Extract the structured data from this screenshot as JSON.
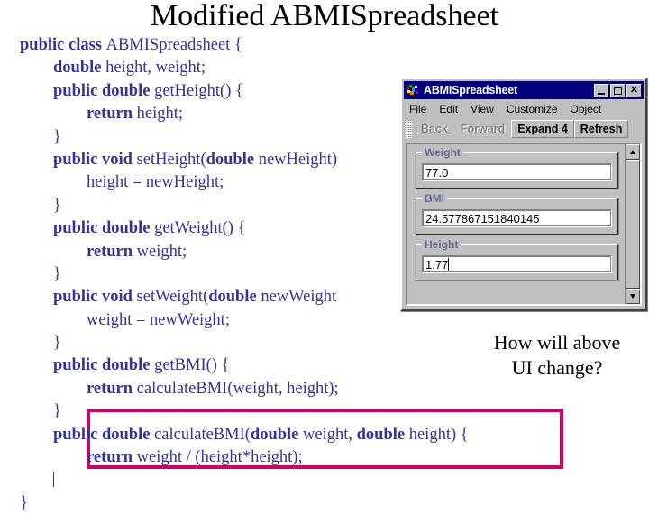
{
  "slide": {
    "title": "Modified ABMISpreadsheet",
    "question": "How will above UI change?",
    "question_line1": "How will above",
    "question_line2": "UI change?",
    "highlight_color": "#cc0066",
    "code_color": "#333399"
  },
  "code": {
    "lines": [
      {
        "indent": 0,
        "parts": [
          {
            "t": "public class ",
            "b": true
          },
          {
            "t": "ABMISpreadsheet {",
            "b": false
          }
        ]
      },
      {
        "indent": 1,
        "parts": [
          {
            "t": "double ",
            "b": true
          },
          {
            "t": "height, weight;",
            "b": false
          }
        ]
      },
      {
        "indent": 1,
        "parts": [
          {
            "t": "public double ",
            "b": true
          },
          {
            "t": "getHeight() {",
            "b": false
          }
        ]
      },
      {
        "indent": 2,
        "parts": [
          {
            "t": "return ",
            "b": true
          },
          {
            "t": "height;",
            "b": false
          }
        ]
      },
      {
        "indent": 1,
        "parts": [
          {
            "t": "}",
            "b": false
          }
        ]
      },
      {
        "indent": 1,
        "parts": [
          {
            "t": "public void ",
            "b": true
          },
          {
            "t": "setHeight(",
            "b": false
          },
          {
            "t": "double ",
            "b": true
          },
          {
            "t": "newHeight)",
            "b": false
          }
        ]
      },
      {
        "indent": 2,
        "parts": [
          {
            "t": "height = newHeight;",
            "b": false
          }
        ]
      },
      {
        "indent": 1,
        "parts": [
          {
            "t": "}",
            "b": false
          }
        ]
      },
      {
        "indent": 1,
        "parts": [
          {
            "t": "public double ",
            "b": true
          },
          {
            "t": "getWeight() {",
            "b": false
          }
        ]
      },
      {
        "indent": 2,
        "parts": [
          {
            "t": "return ",
            "b": true
          },
          {
            "t": "weight;",
            "b": false
          }
        ]
      },
      {
        "indent": 1,
        "parts": [
          {
            "t": "}",
            "b": false
          }
        ]
      },
      {
        "indent": 1,
        "parts": [
          {
            "t": "public void ",
            "b": true
          },
          {
            "t": "setWeight(",
            "b": false
          },
          {
            "t": "double ",
            "b": true
          },
          {
            "t": "newWeight",
            "b": false
          }
        ]
      },
      {
        "indent": 2,
        "parts": [
          {
            "t": "weight = newWeight;",
            "b": false
          }
        ]
      },
      {
        "indent": 1,
        "parts": [
          {
            "t": "}",
            "b": false
          }
        ]
      },
      {
        "indent": 1,
        "parts": [
          {
            "t": "public double ",
            "b": true
          },
          {
            "t": "getBMI() {",
            "b": false
          }
        ]
      },
      {
        "indent": 2,
        "parts": [
          {
            "t": "return ",
            "b": true
          },
          {
            "t": "calculateBMI(weight, height);",
            "b": false
          }
        ]
      },
      {
        "indent": 1,
        "parts": [
          {
            "t": "}",
            "b": false
          }
        ]
      },
      {
        "indent": 1,
        "parts": [
          {
            "t": "public double ",
            "b": true
          },
          {
            "t": "calculateBMI(",
            "b": false
          },
          {
            "t": "double ",
            "b": true
          },
          {
            "t": "weight, ",
            "b": false
          },
          {
            "t": "double ",
            "b": true
          },
          {
            "t": "height) {",
            "b": false
          }
        ]
      },
      {
        "indent": 2,
        "parts": [
          {
            "t": "return ",
            "b": true
          },
          {
            "t": "weight / (height*height);",
            "b": false
          }
        ]
      },
      {
        "indent": 1,
        "parts": [
          {
            "t": "",
            "b": false
          }
        ],
        "caret": true
      },
      {
        "indent": 0,
        "parts": [
          {
            "t": "}",
            "b": false
          }
        ]
      }
    ]
  },
  "window": {
    "title": "ABMISpreadsheet",
    "icon": "app-icon",
    "controls": {
      "minimize": "_",
      "maximize": "□",
      "close": "✕"
    },
    "menu": [
      {
        "label": "File"
      },
      {
        "label": "Edit"
      },
      {
        "label": "View"
      },
      {
        "label": "Customize"
      },
      {
        "label": "Object"
      }
    ],
    "toolbar": [
      {
        "label": "Back",
        "enabled": false
      },
      {
        "label": "Forward",
        "enabled": false
      },
      {
        "label": "Expand 4",
        "enabled": true
      },
      {
        "label": "Refresh",
        "enabled": true
      }
    ],
    "fields": [
      {
        "label": "Weight",
        "value": "77.0",
        "caret": false
      },
      {
        "label": "BMI",
        "value": "24.577867151840145",
        "caret": false
      },
      {
        "label": "Height",
        "value": "1.77",
        "caret": true
      }
    ],
    "scrollbar": {
      "up": "▲",
      "down": "▼"
    }
  }
}
